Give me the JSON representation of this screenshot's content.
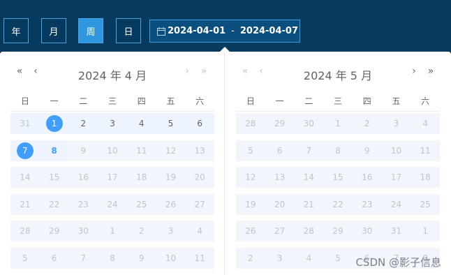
{
  "modes": [
    {
      "label": "年",
      "active": false
    },
    {
      "label": "月",
      "active": false
    },
    {
      "label": "周",
      "active": true
    },
    {
      "label": "日",
      "active": false
    }
  ],
  "range": {
    "start": "2024-04-01",
    "separator": "-",
    "end": "2024-04-07",
    "icon": "calendar-icon"
  },
  "weekdays": [
    "日",
    "一",
    "二",
    "三",
    "四",
    "五",
    "六"
  ],
  "left_panel": {
    "title": "2024 年 4 月",
    "prev_year": "«",
    "prev_month": "‹",
    "next_month": "›",
    "next_year": "»",
    "weeks": [
      [
        "31",
        "1",
        "2",
        "3",
        "4",
        "5",
        "6"
      ],
      [
        "7",
        "8",
        "9",
        "10",
        "11",
        "12",
        "13"
      ],
      [
        "14",
        "15",
        "16",
        "17",
        "18",
        "19",
        "20"
      ],
      [
        "21",
        "22",
        "23",
        "24",
        "25",
        "26",
        "27"
      ],
      [
        "28",
        "29",
        "30",
        "1",
        "2",
        "3",
        "4"
      ],
      [
        "5",
        "6",
        "7",
        "8",
        "9",
        "10",
        "11"
      ]
    ]
  },
  "right_panel": {
    "title": "2024 年 5 月",
    "prev_year": "«",
    "prev_month": "‹",
    "next_month": "›",
    "next_year": "»",
    "weeks": [
      [
        "28",
        "29",
        "30",
        "1",
        "2",
        "3",
        "4"
      ],
      [
        "5",
        "6",
        "7",
        "8",
        "9",
        "10",
        "11"
      ],
      [
        "12",
        "13",
        "14",
        "15",
        "16",
        "17",
        "18"
      ],
      [
        "19",
        "20",
        "21",
        "22",
        "23",
        "24",
        "25"
      ],
      [
        "26",
        "27",
        "28",
        "29",
        "30",
        "31",
        "1"
      ],
      [
        "2",
        "3",
        "4",
        "5",
        "6",
        "7",
        "8"
      ]
    ]
  },
  "watermark": "CSDN @影子信息",
  "colors": {
    "header_bg": "#063a5e",
    "accent": "#409eff",
    "active_mode": "#2f96e0"
  }
}
